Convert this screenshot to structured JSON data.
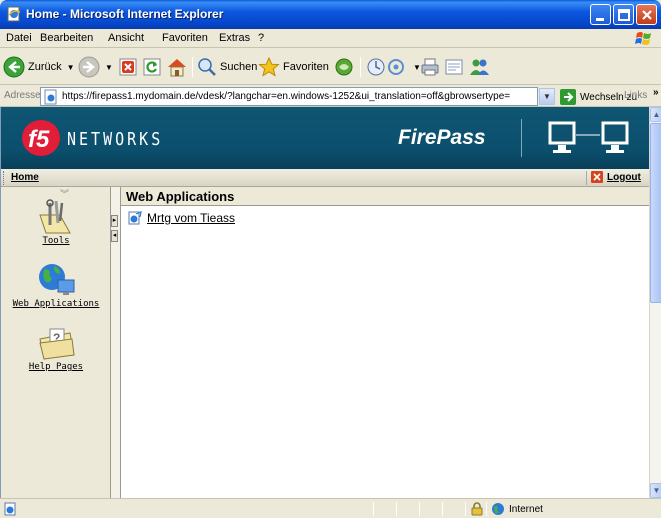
{
  "window": {
    "title": "Home - Microsoft Internet Explorer"
  },
  "menubar": {
    "items": [
      "Datei",
      "Bearbeiten",
      "Ansicht",
      "Favoriten",
      "Extras",
      "?"
    ]
  },
  "toolbar": {
    "back_label": "Zurück",
    "search_label": "Suchen",
    "favorites_label": "Favoriten"
  },
  "addressbar": {
    "label": "Adresse",
    "url": "https://firepass1.mydomain.de/vdesk/?langchar=en.windows-1252&ui_translation=off&gbrowsertype=",
    "go_label": "Wechseln zu",
    "links_label": "Links",
    "links_more": "»"
  },
  "banner": {
    "logo_text": "f5",
    "networks_text": "NETWORKS",
    "product_name": "FirePass"
  },
  "navbar": {
    "home_label": "Home",
    "logout_label": "Logout"
  },
  "leftnav": {
    "items": [
      {
        "label": "Tools",
        "icon": "tools-icon"
      },
      {
        "label": "Web Applications",
        "icon": "globe-monitor-icon"
      },
      {
        "label": "Help Pages",
        "icon": "help-folder-icon"
      }
    ]
  },
  "content": {
    "title": "Web Applications",
    "applications": [
      {
        "label": "Mrtg vom Tieass"
      }
    ]
  },
  "statusbar": {
    "zone_label": "Internet"
  },
  "colors": {
    "banner_bg": "#0b4f6d",
    "titlebar_blue": "#0b58e0",
    "chrome_bg": "#ece9d8"
  }
}
